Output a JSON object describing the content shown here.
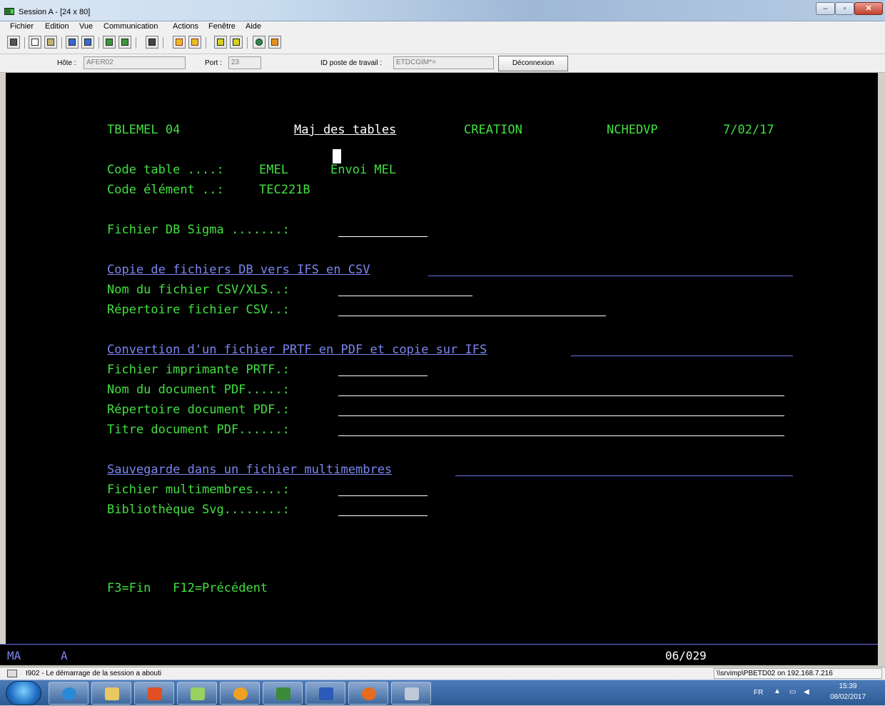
{
  "window": {
    "title": "Session A - [24 x 80]",
    "buttons": {
      "minimize": "–",
      "maximize": "▫",
      "close": "✕"
    }
  },
  "menu": [
    "Fichier",
    "Edition",
    "Vue",
    "Communication",
    "Actions",
    "Fenêtre",
    "Aide"
  ],
  "toolbar": {
    "icons": [
      "screen-icon",
      "copy-icon",
      "paste-icon",
      "send-icon",
      "receive-icon",
      "macro-play-icon",
      "macro-record-icon",
      "screen-capture-icon",
      "color-map-icon",
      "keyboard-map-icon",
      "transfer-up-icon",
      "transfer-down-icon",
      "globe-icon",
      "pencil-icon"
    ]
  },
  "connection": {
    "host_label": "Hôte :",
    "host_value": "AFER02",
    "port_label": "Port :",
    "port_value": "23",
    "workstation_label": "ID poste de travail :",
    "workstation_value": "ETDCGIM*=",
    "disconnect_label": "Déconnexion"
  },
  "screen": {
    "program": "TBLEMEL 04",
    "title": "Maj des tables",
    "mode": "CREATION",
    "user": "NCHEDVP",
    "date": "7/02/17",
    "code_table_label": "Code table ....:",
    "code_table_value": "EMEL",
    "code_table_desc": "Envoi MEL",
    "code_element_label": "Code élément ..:",
    "code_element_value": "TEC221B",
    "fichier_db_label": "Fichier DB Sigma .......:",
    "section1_title": "Copie de fichiers DB vers IFS en CSV",
    "csv_name_label": "Nom du fichier CSV/XLS..:",
    "csv_dir_label": "Répertoire fichier CSV..:",
    "section2_title": "Convertion d'un fichier PRTF en PDF et copie sur IFS",
    "prtf_label": "Fichier imprimante PRTF.:",
    "pdf_name_label": "Nom du document PDF.....:",
    "pdf_dir_label": "Répertoire document PDF.:",
    "pdf_title_label": "Titre document PDF......:",
    "section3_title": "Sauvegarde dans un fichier multimembres",
    "multi_label": "Fichier multimembres....:",
    "lib_label": "Bibliothèque Svg........:",
    "fkeys": "F3=Fin   F12=Précédent"
  },
  "oia": {
    "indicator": "MA",
    "mode": "A",
    "cursor_pos": "06/029"
  },
  "status": {
    "message": "I902 - Le démarrage de la session a abouti",
    "connection": "\\\\srvimp\\PBETD02 on 192.168.7.216"
  },
  "taskbar": {
    "apps": [
      "ie-icon",
      "explorer-icon",
      "office-icon",
      "folder-icon",
      "app-orange-icon",
      "session-icon",
      "word-icon",
      "firefox-icon",
      "snipping-icon"
    ],
    "lang": "FR",
    "time": "15:39",
    "date": "08/02/2017"
  },
  "colors": {
    "terminal_bg": "#000000",
    "text_green": "#41e040",
    "text_blue": "#7a86f0",
    "text_white": "#ffffff"
  }
}
